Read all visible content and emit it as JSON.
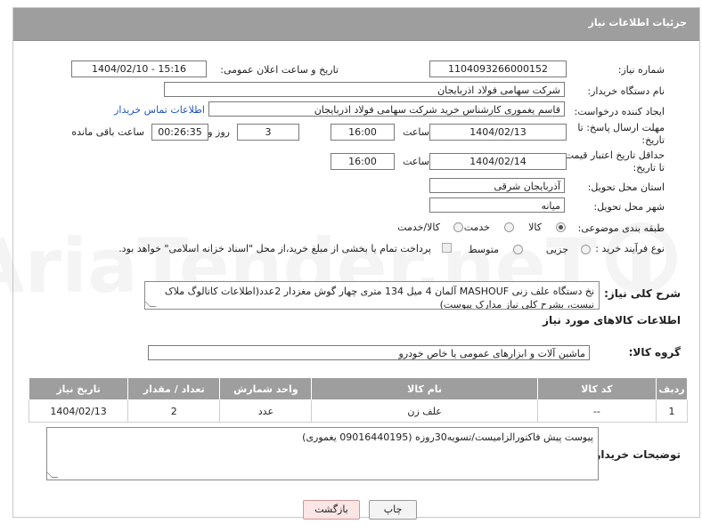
{
  "header": {
    "title": "جزئیات اطلاعات نیاز"
  },
  "fields": {
    "need_number_label": "شماره نیاز:",
    "need_number": "1104093266000152",
    "announce_label": "تاریخ و ساعت اعلان عمومی:",
    "announce_value": "1404/02/10 - 15:16",
    "buyer_org_label": "نام دستگاه خریدار:",
    "buyer_org": "شرکت سهامی فولاد اذربایجان",
    "requester_label": "ایجاد کننده درخواست:",
    "requester": "قاسم یغموری کارشناس خرید شرکت سهامی فولاد اذربایجان",
    "contact_link": "اطلاعات تماس خریدار",
    "deadline_label_1": "مهلت ارسال پاسخ: تا",
    "deadline_label_2": "تاریخ:",
    "deadline_date": "1404/02/13",
    "time_label": "ساعت",
    "deadline_time": "16:00",
    "days_value": "3",
    "days_label": "روز و",
    "remaining_time": "00:26:35",
    "remaining_label": "ساعت باقی مانده",
    "validity_label_1": "حداقل تاریخ اعتبار قیمت:",
    "validity_label_2": "تا تاریخ:",
    "validity_date": "1404/02/14",
    "validity_time": "16:00",
    "province_label": "استان محل تحویل:",
    "province": "آذربایجان شرقی",
    "city_label": "شهر محل تحویل:",
    "city": "میانه",
    "category_label": "طبقه بندی موضوعی:",
    "category_options": [
      "کالا",
      "خدمت",
      "کالا/خدمت"
    ],
    "process_label": "نوع فرآیند خرید :",
    "process_options": [
      "جزیی",
      "متوسط"
    ],
    "payment_note": "پرداخت تمام یا بخشی از مبلغ خرید،از محل \"اسناد خزانه اسلامی\" خواهد بود.",
    "description_label": "شرح کلی نیاز:",
    "description": "نخ دستگاه علف زنی MASHOUF آلمان 4 میل 134 متری چهار گوش مغزدار 2عدد(اطلاعات کاتالوگ ملاک نیست، بشرح کلی نیاز مدارک پیوست)",
    "items_info_title": "اطلاعات کالاهای مورد نیاز",
    "goods_group_label": "گروه کالا:",
    "goods_group": "ماشین آلات و ابزارهای عمومی یا خاص خودرو",
    "buyer_notes_label": "توضیحات خریدار:",
    "buyer_notes": "پیوست پیش فاکتورالزامیست/تسویه30روزه (09016440195 یغموری)"
  },
  "table": {
    "headers": [
      "ردیف",
      "کد کالا",
      "نام کالا",
      "واحد شمارش",
      "تعداد / مقدار",
      "تاریخ نیاز"
    ],
    "rows": [
      [
        "1",
        "--",
        "علف زن",
        "عدد",
        "2",
        "1404/02/13"
      ]
    ]
  },
  "buttons": {
    "print": "چاپ",
    "back": "بازگشت"
  },
  "watermark": {
    "text": "AriaTender.neT"
  }
}
